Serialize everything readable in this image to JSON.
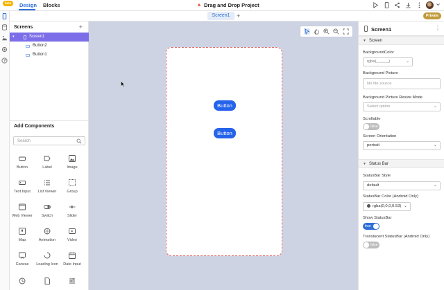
{
  "topbar": {
    "badge": "beta",
    "tabs": [
      {
        "label": "Design"
      },
      {
        "label": "Blocks"
      }
    ],
    "project_title": "Drag and Drop Project"
  },
  "subbar": {
    "screen_tab": "Screen1",
    "add_label": "+",
    "private_label": "Private"
  },
  "screens": {
    "heading": "Screens",
    "add_label": "+",
    "items": [
      {
        "label": "Screen1"
      },
      {
        "label": "Button2"
      },
      {
        "label": "Button1"
      }
    ]
  },
  "components": {
    "heading": "Add Components",
    "search_placeholder": "Search",
    "items": [
      {
        "label": "Button"
      },
      {
        "label": "Label"
      },
      {
        "label": "Image"
      },
      {
        "label": "Text Input"
      },
      {
        "label": "List Viewer"
      },
      {
        "label": "Group"
      },
      {
        "label": "Web Viewer"
      },
      {
        "label": "Switch"
      },
      {
        "label": "Slider"
      },
      {
        "label": "Map"
      },
      {
        "label": "Animation"
      },
      {
        "label": "Video"
      },
      {
        "label": "Canvas"
      },
      {
        "label": "Loading Icon"
      },
      {
        "label": "Date Input"
      }
    ]
  },
  "canvas": {
    "buttons": [
      {
        "label": "Button"
      },
      {
        "label": "Button"
      }
    ]
  },
  "properties": {
    "title": "Screen1",
    "sections": {
      "screen": "Screen",
      "status_bar": "Status Bar"
    },
    "background_color_label": "BackgroundColor",
    "background_color_value": "rgba(_,_,_,_)",
    "background_picture_label": "Background Picture",
    "background_picture_placeholder": "No file source",
    "resize_mode_label": "Background Picture Resize Mode",
    "resize_mode_placeholder": "Select option",
    "scrollable_label": "Scrollable",
    "scrollable_value": "false",
    "orientation_label": "Screen Orientation",
    "orientation_value": "portrait",
    "statusbar_style_label": "StatusBar Style",
    "statusbar_style_value": "default",
    "statusbar_color_label": "StatusBar Color (Android Only)",
    "statusbar_color_value": "rgba(0,0,0,0.53)",
    "show_statusbar_label": "Show StatusBar",
    "show_statusbar_value": "true",
    "translucent_label": "Translucent StatusBar (Android Only)",
    "translucent_value": "false"
  },
  "colors": {
    "accent": "#2f6fd6",
    "selection": "#7b6ee8",
    "app_button": "#2563eb",
    "private": "#c19a3a",
    "canvas_bg": "#cdd3e3"
  }
}
